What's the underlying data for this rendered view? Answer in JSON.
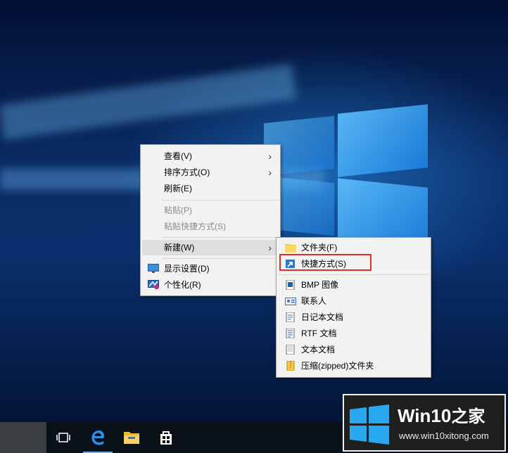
{
  "context_menu": {
    "items": [
      {
        "label": "查看(V)",
        "has_submenu": true
      },
      {
        "label": "排序方式(O)",
        "has_submenu": true
      },
      {
        "label": "刷新(E)"
      },
      {
        "label": "粘贴(P)",
        "disabled": true
      },
      {
        "label": "粘贴快捷方式(S)",
        "disabled": true
      },
      {
        "label": "新建(W)",
        "has_submenu": true,
        "highlighted": true
      },
      {
        "label": "显示设置(D)",
        "icon": "display-settings-icon"
      },
      {
        "label": "个性化(R)",
        "icon": "personalize-icon"
      }
    ]
  },
  "new_submenu": {
    "items": [
      {
        "label": "文件夹(F)",
        "icon": "folder-icon"
      },
      {
        "label": "快捷方式(S)",
        "icon": "shortcut-icon",
        "annotated": true
      },
      {
        "label": "BMP 图像",
        "icon": "bmp-image-icon"
      },
      {
        "label": "联系人",
        "icon": "contact-icon"
      },
      {
        "label": "日记本文档",
        "icon": "journal-icon"
      },
      {
        "label": "RTF 文档",
        "icon": "rtf-document-icon"
      },
      {
        "label": "文本文档",
        "icon": "text-document-icon"
      },
      {
        "label": "压缩(zipped)文件夹",
        "icon": "zip-folder-icon"
      }
    ]
  },
  "taskbar": {
    "icons": [
      "task-view-icon",
      "edge-icon",
      "file-explorer-icon",
      "store-icon"
    ]
  },
  "watermark": {
    "title": "Win10",
    "title_zh": "之家",
    "url": "www.win10xitong.com"
  },
  "colors": {
    "annotation_red": "#e0302e",
    "menu_bg": "#f2f2f2",
    "menu_hover": "#dedede",
    "taskbar_bg": "#0b1119"
  }
}
